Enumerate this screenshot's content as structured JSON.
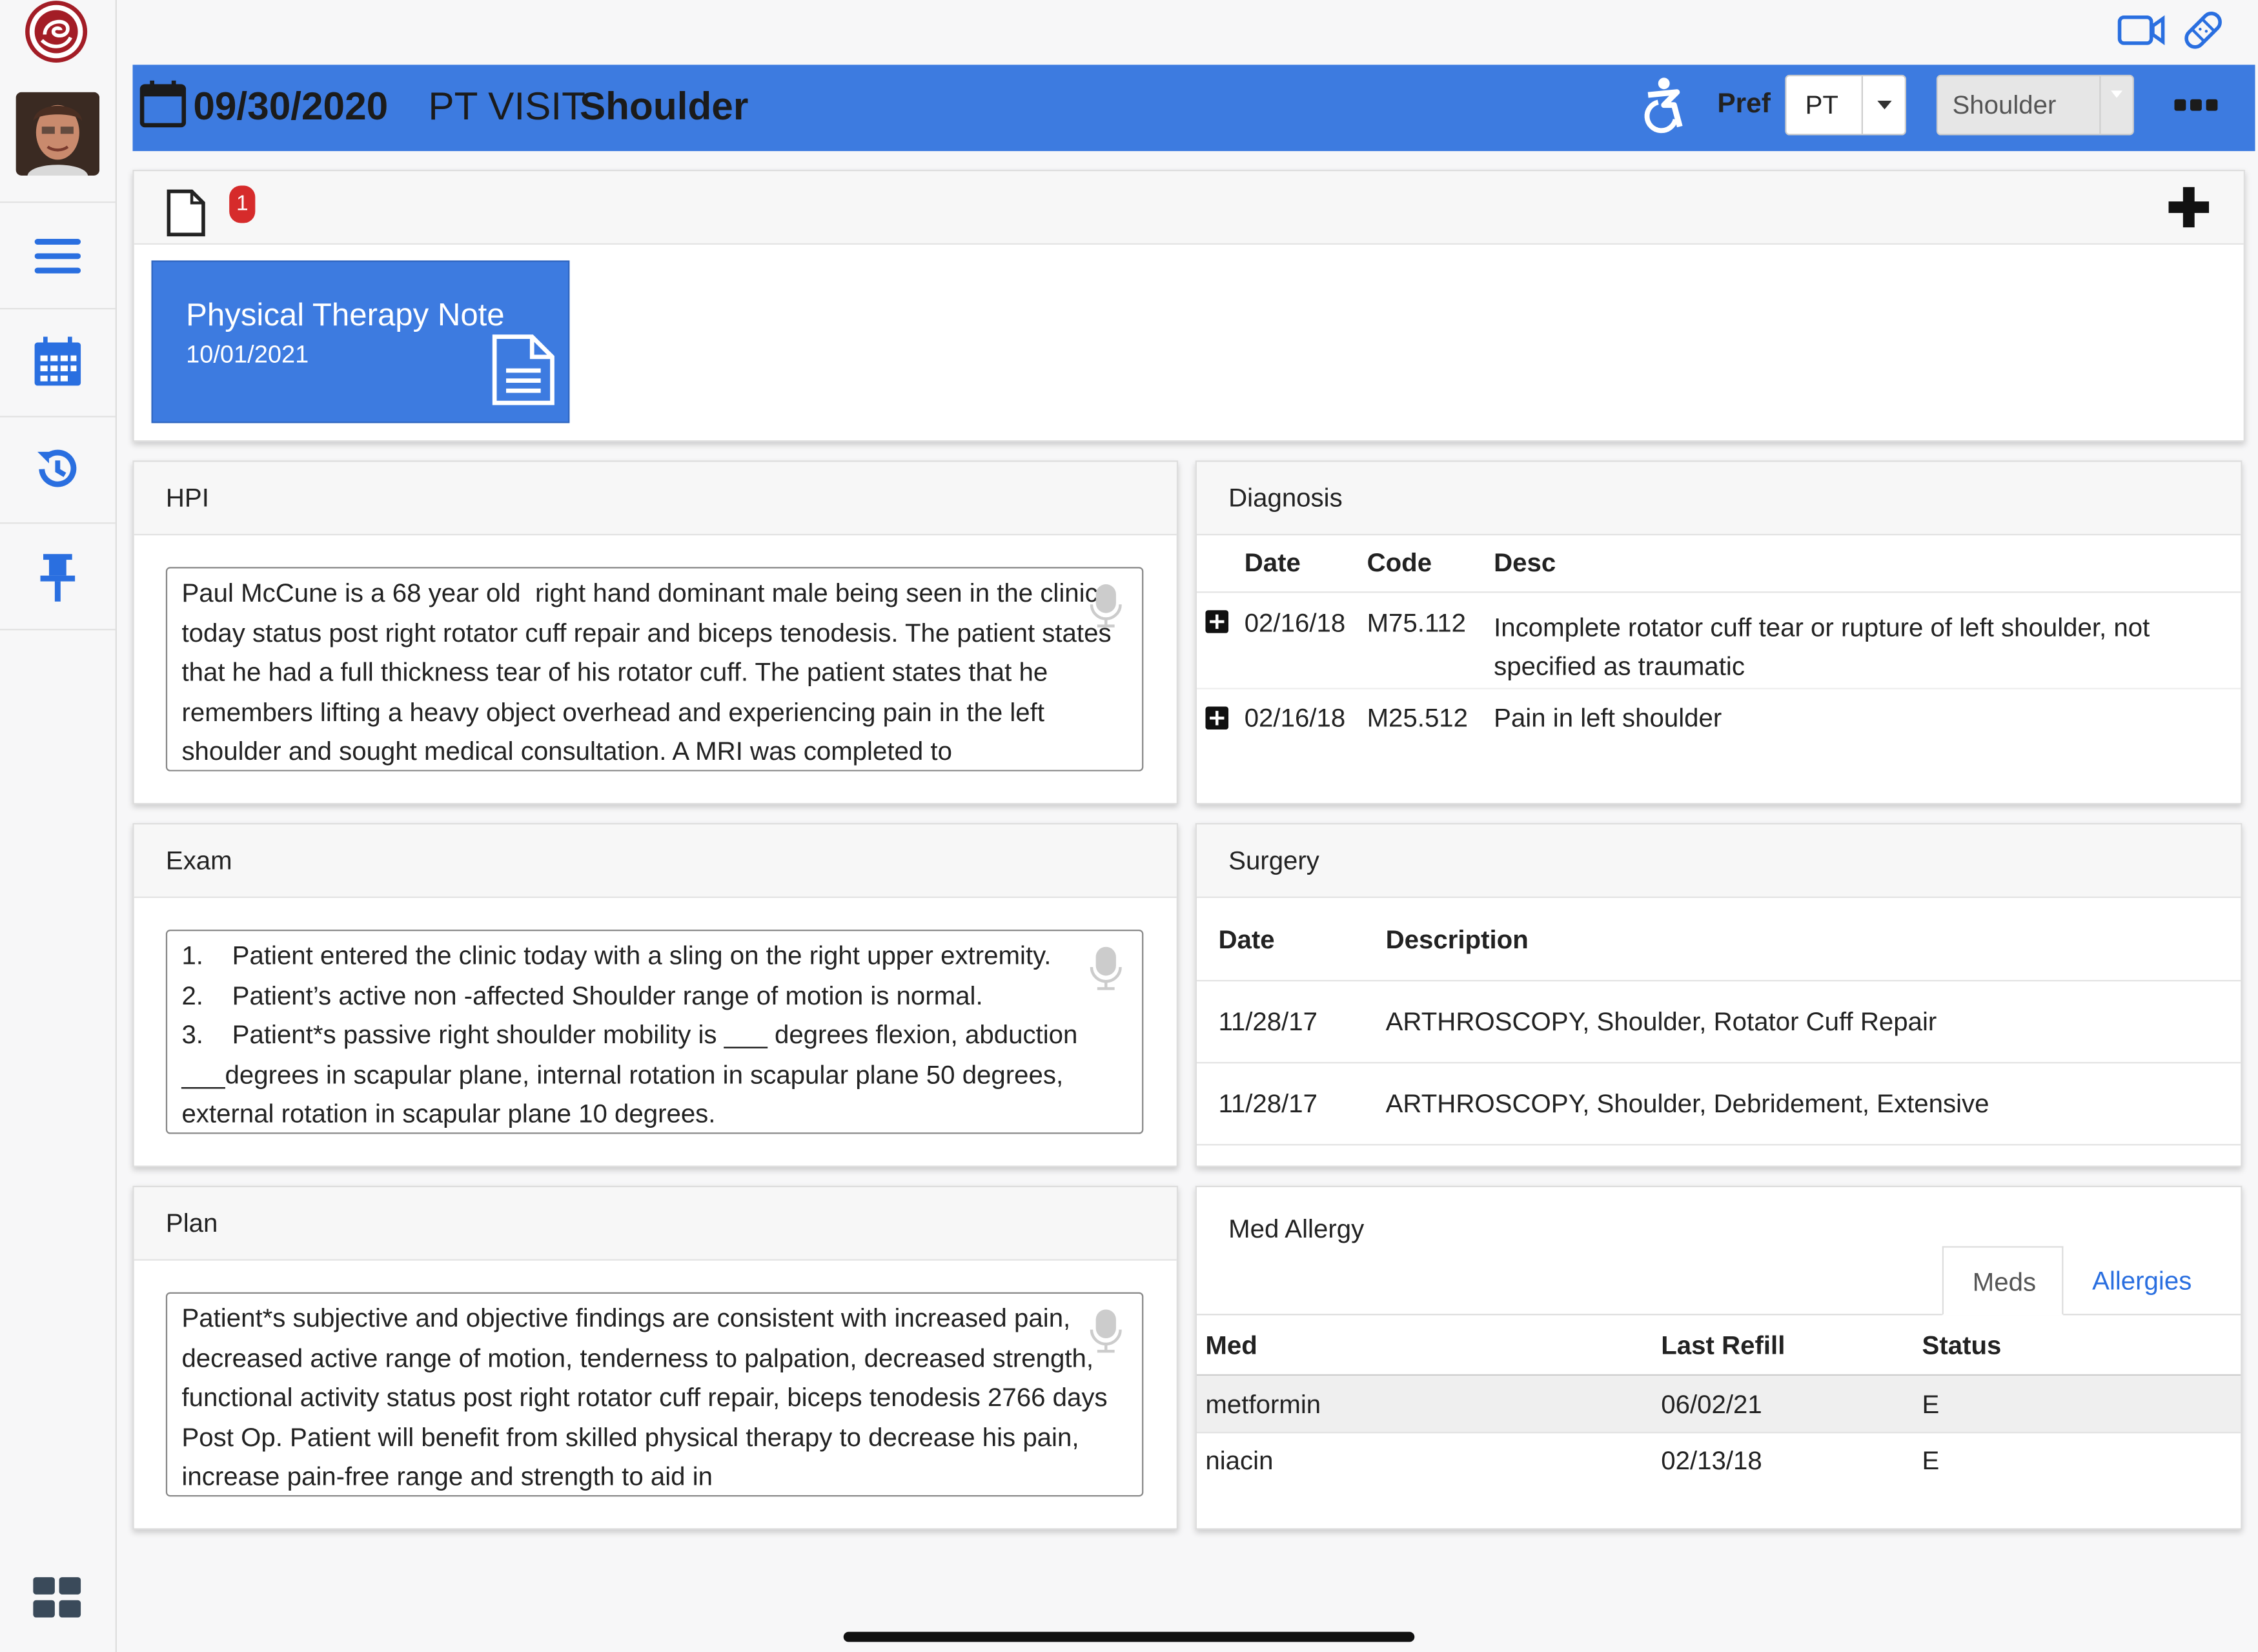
{
  "header": {
    "date": "09/30/2020",
    "visit_type": "PT VISIT",
    "body_site": "Shoulder",
    "pref_label": "Pref",
    "pref_value": "PT",
    "site_value": "Shoulder",
    "accent_color": "#3d7be0"
  },
  "notes": {
    "badge_count": "1",
    "card": {
      "title": "Physical Therapy Note",
      "date": "10/01/2021"
    }
  },
  "hpi": {
    "title": "HPI",
    "text": "Paul McCune is a 68 year old  right hand dominant male being seen in the clinic today status post right rotator cuff repair and biceps tenodesis. The patient states that he had a full thickness tear of his rotator cuff. The patient states that he remembers lifting a heavy object overhead and experiencing pain in the left shoulder and sought medical consultation. A MRI was completed to"
  },
  "exam": {
    "title": "Exam",
    "text": "1.    Patient entered the clinic today with a sling on the right upper extremity.\n2.    Patient’s active non -affected Shoulder range of motion is normal.\n3.    Patient*s passive right shoulder mobility is ___ degrees flexion, abduction ___degrees in scapular plane, internal rotation in scapular plane 50 degrees, external rotation in scapular plane 10 degrees."
  },
  "plan": {
    "title": "Plan",
    "text": "Patient*s subjective and objective findings are consistent with increased pain, decreased active range of motion, tenderness to palpation, decreased strength, functional activity status post right rotator cuff repair, biceps tenodesis 2766 days Post Op. Patient will benefit from skilled physical therapy to decrease his pain, increase pain-free range and strength to aid in"
  },
  "diagnosis": {
    "title": "Diagnosis",
    "columns": [
      "Date",
      "Code",
      "Desc"
    ],
    "rows": [
      {
        "date": "02/16/18",
        "code": "M75.112",
        "desc": "Incomplete rotator cuff tear or rupture of left shoulder, not specified as traumatic"
      },
      {
        "date": "02/16/18",
        "code": "M25.512",
        "desc": "Pain in left shoulder"
      }
    ]
  },
  "surgery": {
    "title": "Surgery",
    "columns": [
      "Date",
      "Description"
    ],
    "rows": [
      {
        "date": "11/28/17",
        "desc": "ARTHROSCOPY, Shoulder, Rotator Cuff Repair"
      },
      {
        "date": "11/28/17",
        "desc": "ARTHROSCOPY, Shoulder, Debridement, Extensive"
      }
    ]
  },
  "med_allergy": {
    "title": "Med Allergy",
    "tabs": [
      "Meds",
      "Allergies"
    ],
    "columns": [
      "Med",
      "Last Refill",
      "Status"
    ],
    "rows": [
      {
        "med": "metformin",
        "refill": "06/02/21",
        "status": "E"
      },
      {
        "med": "niacin",
        "refill": "02/13/18",
        "status": "E"
      }
    ]
  }
}
